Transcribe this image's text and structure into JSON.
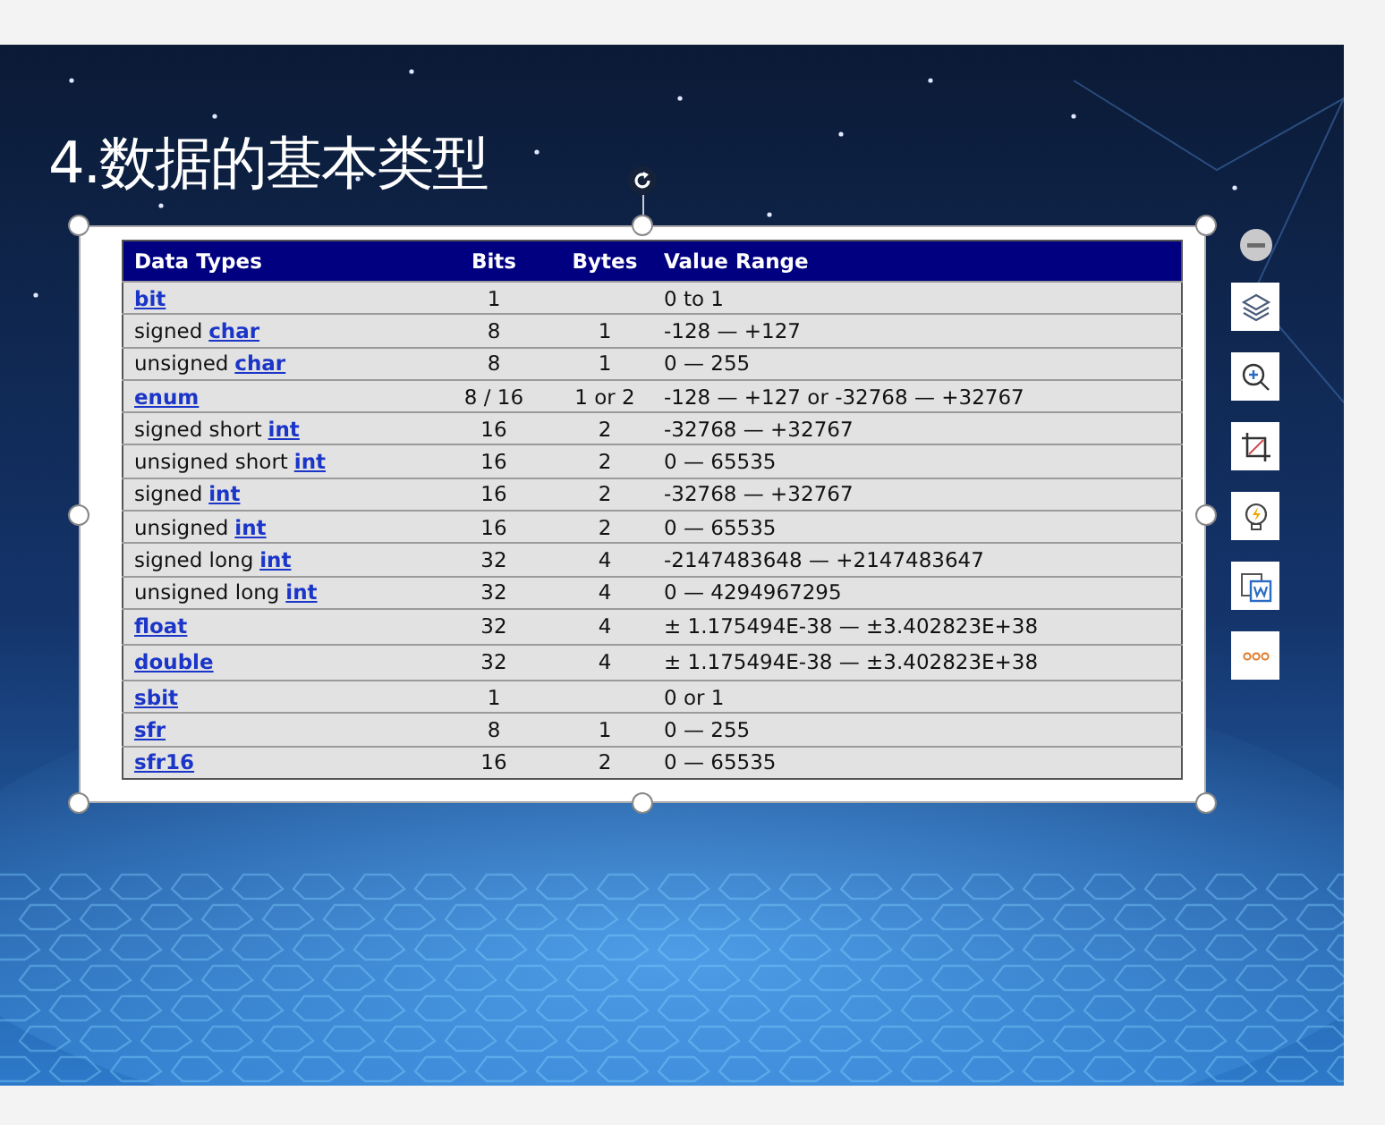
{
  "slide": {
    "title": "4.数据的基本类型"
  },
  "table": {
    "columns": [
      "Data Types",
      "Bits",
      "Bytes",
      "Value Range"
    ],
    "rows": [
      {
        "type": {
          "link": "bit"
        },
        "bits": "1",
        "range": "0 to 1"
      },
      {
        "type": {
          "prefix": "signed",
          "link": "char"
        },
        "bits": "8",
        "bytes": "1",
        "range": "-128 — +127"
      },
      {
        "type": {
          "prefix": "unsigned",
          "link": "char"
        },
        "bits": "8",
        "bytes": "1",
        "range": "0 — 255"
      },
      {
        "type": {
          "link": "enum"
        },
        "bits": "8 / 16",
        "bytes": "1 or 2",
        "range": "-128 — +127 or -32768 — +32767"
      },
      {
        "type": {
          "prefix": "signed short",
          "link": "int"
        },
        "bits": "16",
        "bytes": "2",
        "range": "-32768 — +32767"
      },
      {
        "type": {
          "prefix": "unsigned short",
          "link": "int"
        },
        "bits": "16",
        "bytes": "2",
        "range": "0 — 65535"
      },
      {
        "type": {
          "prefix": "signed",
          "link": "int"
        },
        "bits": "16",
        "bytes": "2",
        "range": "-32768 — +32767"
      },
      {
        "type": {
          "prefix": "unsigned",
          "link": "int"
        },
        "bits": "16",
        "bytes": "2",
        "range": "0 — 65535"
      },
      {
        "type": {
          "prefix": "signed long",
          "link": "int"
        },
        "bits": "32",
        "bytes": "4",
        "range": "-2147483648 — +2147483647"
      },
      {
        "type": {
          "prefix": "unsigned long",
          "link": "int"
        },
        "bits": "32",
        "bytes": "4",
        "range": "0 — 4294967295"
      },
      {
        "type": {
          "link": "float"
        },
        "bits": "32",
        "bytes": "4",
        "range": "± 1.175494E-38 — ±3.402823E+38"
      },
      {
        "type": {
          "link": "double"
        },
        "bits": "32",
        "bytes": "4",
        "range": "± 1.175494E-38 — ±3.402823E+38"
      },
      {
        "type": {
          "link": "sbit"
        },
        "bits": "1",
        "range": "0 or 1"
      },
      {
        "type": {
          "link": "sfr"
        },
        "bits": "8",
        "bytes": "1",
        "range": "0 — 255"
      },
      {
        "type": {
          "link": "sfr16"
        },
        "bits": "16",
        "bytes": "2",
        "range": "0 — 65535"
      }
    ]
  }
}
